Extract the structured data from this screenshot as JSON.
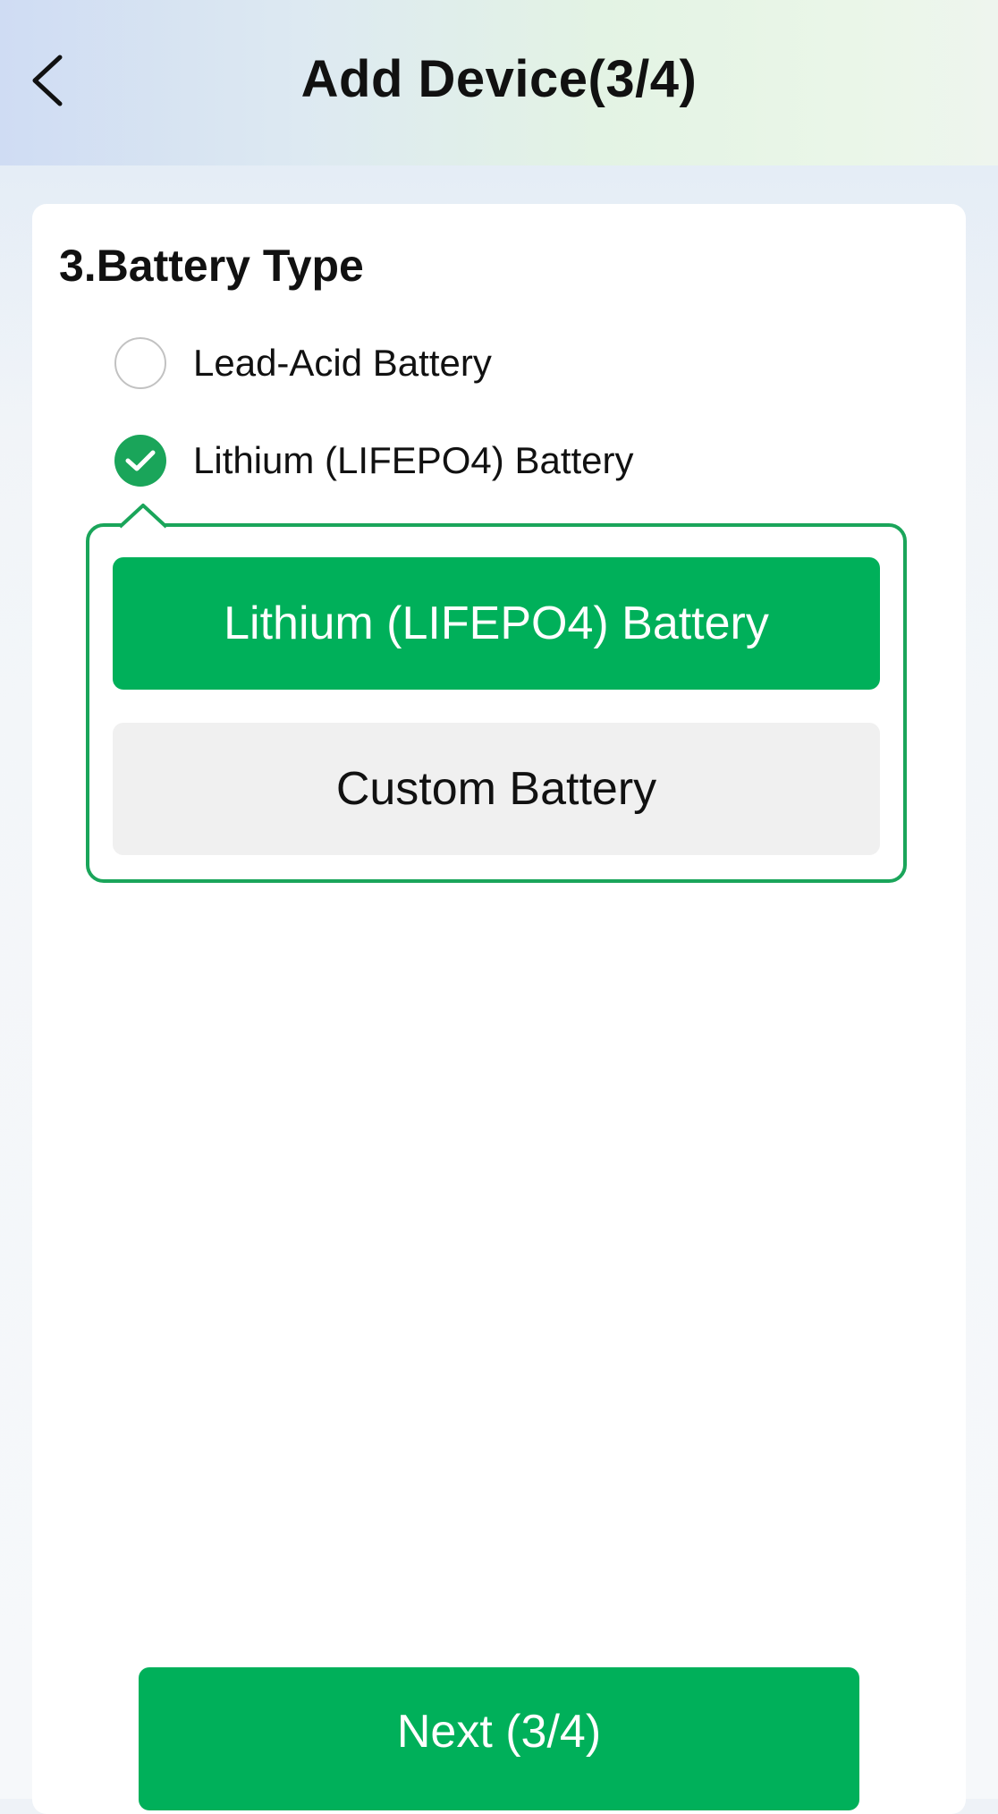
{
  "header": {
    "title": "Add Device(3/4)",
    "back_icon": "chevron-left-icon"
  },
  "section": {
    "title": "3.Battery Type"
  },
  "battery_options": [
    {
      "label": "Lead-Acid Battery",
      "selected": false
    },
    {
      "label": "Lithium (LIFEPO4) Battery",
      "selected": true
    }
  ],
  "lithium_submenu": {
    "options": [
      {
        "label": "Lithium (LIFEPO4) Battery",
        "selected": true
      },
      {
        "label": "Custom Battery",
        "selected": false
      }
    ]
  },
  "footer": {
    "next_label": "Next (3/4)"
  },
  "colors": {
    "accent": "#00b05a",
    "accent_border": "#1aa55a",
    "secondary_bg": "#f0f0f0"
  }
}
